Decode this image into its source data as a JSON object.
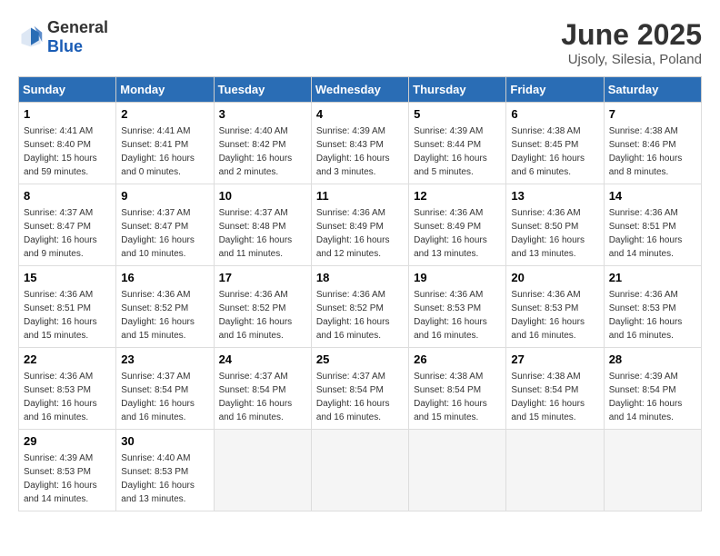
{
  "header": {
    "logo_general": "General",
    "logo_blue": "Blue",
    "title": "June 2025",
    "subtitle": "Ujsoly, Silesia, Poland"
  },
  "weekdays": [
    "Sunday",
    "Monday",
    "Tuesday",
    "Wednesday",
    "Thursday",
    "Friday",
    "Saturday"
  ],
  "weeks": [
    [
      {
        "day": "1",
        "sunrise": "4:41 AM",
        "sunset": "8:40 PM",
        "daylight": "15 hours and 59 minutes."
      },
      {
        "day": "2",
        "sunrise": "4:41 AM",
        "sunset": "8:41 PM",
        "daylight": "16 hours and 0 minutes."
      },
      {
        "day": "3",
        "sunrise": "4:40 AM",
        "sunset": "8:42 PM",
        "daylight": "16 hours and 2 minutes."
      },
      {
        "day": "4",
        "sunrise": "4:39 AM",
        "sunset": "8:43 PM",
        "daylight": "16 hours and 3 minutes."
      },
      {
        "day": "5",
        "sunrise": "4:39 AM",
        "sunset": "8:44 PM",
        "daylight": "16 hours and 5 minutes."
      },
      {
        "day": "6",
        "sunrise": "4:38 AM",
        "sunset": "8:45 PM",
        "daylight": "16 hours and 6 minutes."
      },
      {
        "day": "7",
        "sunrise": "4:38 AM",
        "sunset": "8:46 PM",
        "daylight": "16 hours and 8 minutes."
      }
    ],
    [
      {
        "day": "8",
        "sunrise": "4:37 AM",
        "sunset": "8:47 PM",
        "daylight": "16 hours and 9 minutes."
      },
      {
        "day": "9",
        "sunrise": "4:37 AM",
        "sunset": "8:47 PM",
        "daylight": "16 hours and 10 minutes."
      },
      {
        "day": "10",
        "sunrise": "4:37 AM",
        "sunset": "8:48 PM",
        "daylight": "16 hours and 11 minutes."
      },
      {
        "day": "11",
        "sunrise": "4:36 AM",
        "sunset": "8:49 PM",
        "daylight": "16 hours and 12 minutes."
      },
      {
        "day": "12",
        "sunrise": "4:36 AM",
        "sunset": "8:49 PM",
        "daylight": "16 hours and 13 minutes."
      },
      {
        "day": "13",
        "sunrise": "4:36 AM",
        "sunset": "8:50 PM",
        "daylight": "16 hours and 13 minutes."
      },
      {
        "day": "14",
        "sunrise": "4:36 AM",
        "sunset": "8:51 PM",
        "daylight": "16 hours and 14 minutes."
      }
    ],
    [
      {
        "day": "15",
        "sunrise": "4:36 AM",
        "sunset": "8:51 PM",
        "daylight": "16 hours and 15 minutes."
      },
      {
        "day": "16",
        "sunrise": "4:36 AM",
        "sunset": "8:52 PM",
        "daylight": "16 hours and 15 minutes."
      },
      {
        "day": "17",
        "sunrise": "4:36 AM",
        "sunset": "8:52 PM",
        "daylight": "16 hours and 16 minutes."
      },
      {
        "day": "18",
        "sunrise": "4:36 AM",
        "sunset": "8:52 PM",
        "daylight": "16 hours and 16 minutes."
      },
      {
        "day": "19",
        "sunrise": "4:36 AM",
        "sunset": "8:53 PM",
        "daylight": "16 hours and 16 minutes."
      },
      {
        "day": "20",
        "sunrise": "4:36 AM",
        "sunset": "8:53 PM",
        "daylight": "16 hours and 16 minutes."
      },
      {
        "day": "21",
        "sunrise": "4:36 AM",
        "sunset": "8:53 PM",
        "daylight": "16 hours and 16 minutes."
      }
    ],
    [
      {
        "day": "22",
        "sunrise": "4:36 AM",
        "sunset": "8:53 PM",
        "daylight": "16 hours and 16 minutes."
      },
      {
        "day": "23",
        "sunrise": "4:37 AM",
        "sunset": "8:54 PM",
        "daylight": "16 hours and 16 minutes."
      },
      {
        "day": "24",
        "sunrise": "4:37 AM",
        "sunset": "8:54 PM",
        "daylight": "16 hours and 16 minutes."
      },
      {
        "day": "25",
        "sunrise": "4:37 AM",
        "sunset": "8:54 PM",
        "daylight": "16 hours and 16 minutes."
      },
      {
        "day": "26",
        "sunrise": "4:38 AM",
        "sunset": "8:54 PM",
        "daylight": "16 hours and 15 minutes."
      },
      {
        "day": "27",
        "sunrise": "4:38 AM",
        "sunset": "8:54 PM",
        "daylight": "16 hours and 15 minutes."
      },
      {
        "day": "28",
        "sunrise": "4:39 AM",
        "sunset": "8:54 PM",
        "daylight": "16 hours and 14 minutes."
      }
    ],
    [
      {
        "day": "29",
        "sunrise": "4:39 AM",
        "sunset": "8:53 PM",
        "daylight": "16 hours and 14 minutes."
      },
      {
        "day": "30",
        "sunrise": "4:40 AM",
        "sunset": "8:53 PM",
        "daylight": "16 hours and 13 minutes."
      },
      null,
      null,
      null,
      null,
      null
    ]
  ]
}
